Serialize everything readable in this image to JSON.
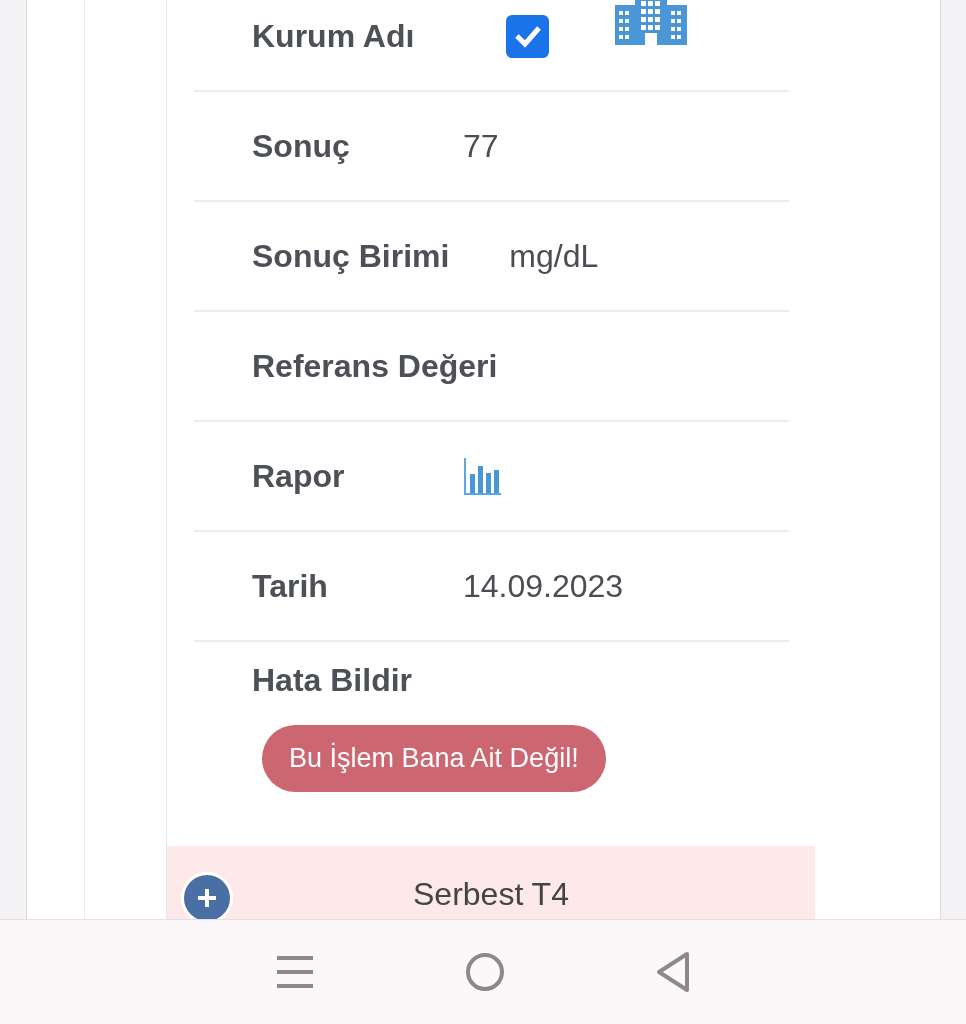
{
  "rows": [
    {
      "kind": "checkbox",
      "label": "Kurum Adı",
      "checked": true
    },
    {
      "kind": "text",
      "label": "Sonuç",
      "value": "77"
    },
    {
      "kind": "text",
      "label": "Sonuç Birimi",
      "value": "mg/dL"
    },
    {
      "kind": "text",
      "label": "Referans Değeri"
    },
    {
      "kind": "report",
      "label": "Rapor"
    },
    {
      "kind": "text",
      "label": "Tarih",
      "value": "14.09.2023"
    },
    {
      "kind": "button",
      "label": "Hata Bildir",
      "button": "Bu İşlem Bana Ait Değil!"
    }
  ],
  "next_item": {
    "title": "Serbest T4"
  }
}
